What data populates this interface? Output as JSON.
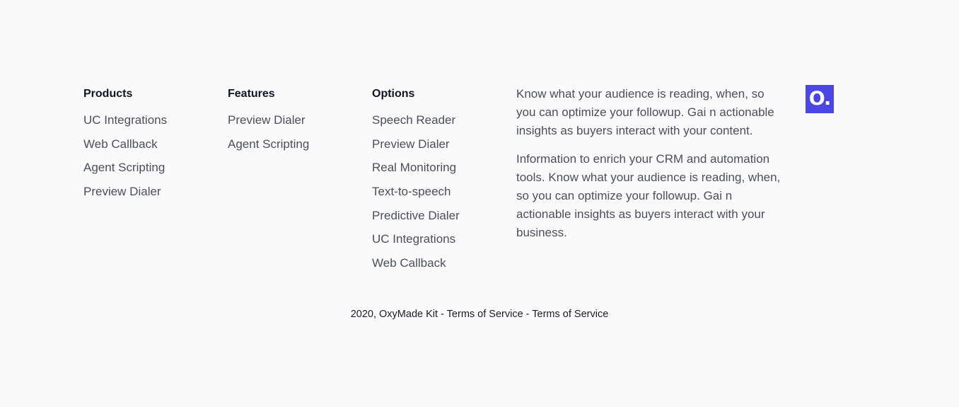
{
  "columns": {
    "products": {
      "heading": "Products",
      "links": [
        "UC Integrations",
        "Web Callback",
        "Agent Scripting",
        "Preview Dialer"
      ]
    },
    "features": {
      "heading": "Features",
      "links": [
        "Preview Dialer",
        "Agent Scripting"
      ]
    },
    "options": {
      "heading": "Options",
      "links": [
        "Speech Reader",
        "Preview Dialer",
        "Real Monitoring",
        "Text-to-speech",
        "Predictive Dialer",
        "UC Integrations",
        "Web Callback"
      ]
    }
  },
  "about": {
    "paragraph_1": "Know what your audience is reading, when, so you can optimize your followup. Gai n actionable insights as buyers interact with your content.",
    "paragraph_2": "Information to enrich your CRM and automation tools. Know what your audience is reading, when, so you can optimize your followup. Gai n actionable insights as buyers interact with your business."
  },
  "logo": {
    "text": "O.",
    "color": "#4a46e4"
  },
  "bottom": {
    "copyright": "2020, OxyMade Kit",
    "separator_1": " - ",
    "terms_1": "Terms of Service",
    "separator_2": " - ",
    "terms_2": "Terms of Service"
  }
}
